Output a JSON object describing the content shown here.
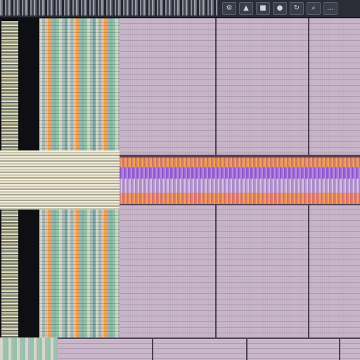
{
  "app": {
    "toolbar_buttons": [
      {
        "icon": "settings-icon",
        "glyph": "⚙"
      },
      {
        "icon": "cursor-icon",
        "glyph": "▲"
      },
      {
        "icon": "stop-icon",
        "glyph": "■"
      },
      {
        "icon": "record-icon",
        "glyph": "●"
      },
      {
        "icon": "loop-icon",
        "glyph": "↻"
      },
      {
        "icon": "zoom-icon",
        "glyph": "⌕"
      },
      {
        "icon": "more-icon",
        "glyph": "…"
      }
    ]
  },
  "colors": {
    "canvas": "#c9b6c9",
    "grid_line": "#4a4058",
    "selection_orange": "#f0a45a",
    "selection_purple": "#a06ad6",
    "toolbar": "#2a2d36"
  }
}
